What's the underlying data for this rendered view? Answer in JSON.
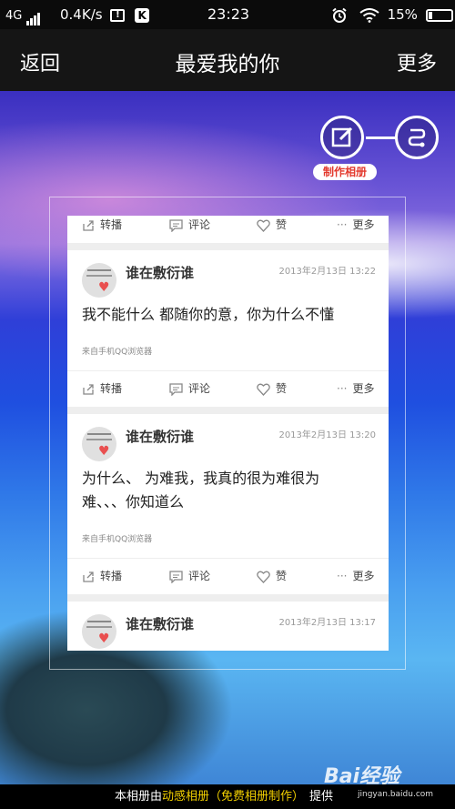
{
  "status_bar": {
    "network": "4G",
    "speed": "0.4K/s",
    "k_badge": "K",
    "time": "23:23",
    "battery": "15%"
  },
  "header": {
    "back_label": "返回",
    "title": "最爱我的你",
    "more_label": "更多"
  },
  "make_album": {
    "label": "制作相册"
  },
  "actions": {
    "repost": "转播",
    "comment": "评论",
    "like": "赞",
    "more": "更多"
  },
  "posts": [
    {
      "author": "谁在敷衍谁",
      "time": "2013年2月13日 13:22",
      "text": "我不能什么 都随你的意，你为什么不懂",
      "source": "来自手机QQ浏览器"
    },
    {
      "author": "谁在敷衍谁",
      "time": "2013年2月13日 13:20",
      "text_line1": "为什么、 为难我，我真的很为难很为",
      "text_line2": "难、、、你知道么",
      "source": "来自手机QQ浏览器"
    },
    {
      "author": "谁在敷衍谁",
      "time": "2013年2月13日 13:17"
    }
  ],
  "footer": {
    "prefix": "本相册由",
    "highlight": "动感相册（免费相册制作）",
    "suffix": "提供"
  },
  "watermark": {
    "logo": "Bai经验",
    "url": "jingyan.baidu.com"
  },
  "colors": {
    "footer_highlight": "#f2d000",
    "make_album_label": "#e33a2e",
    "heart": "#e94f4f"
  }
}
